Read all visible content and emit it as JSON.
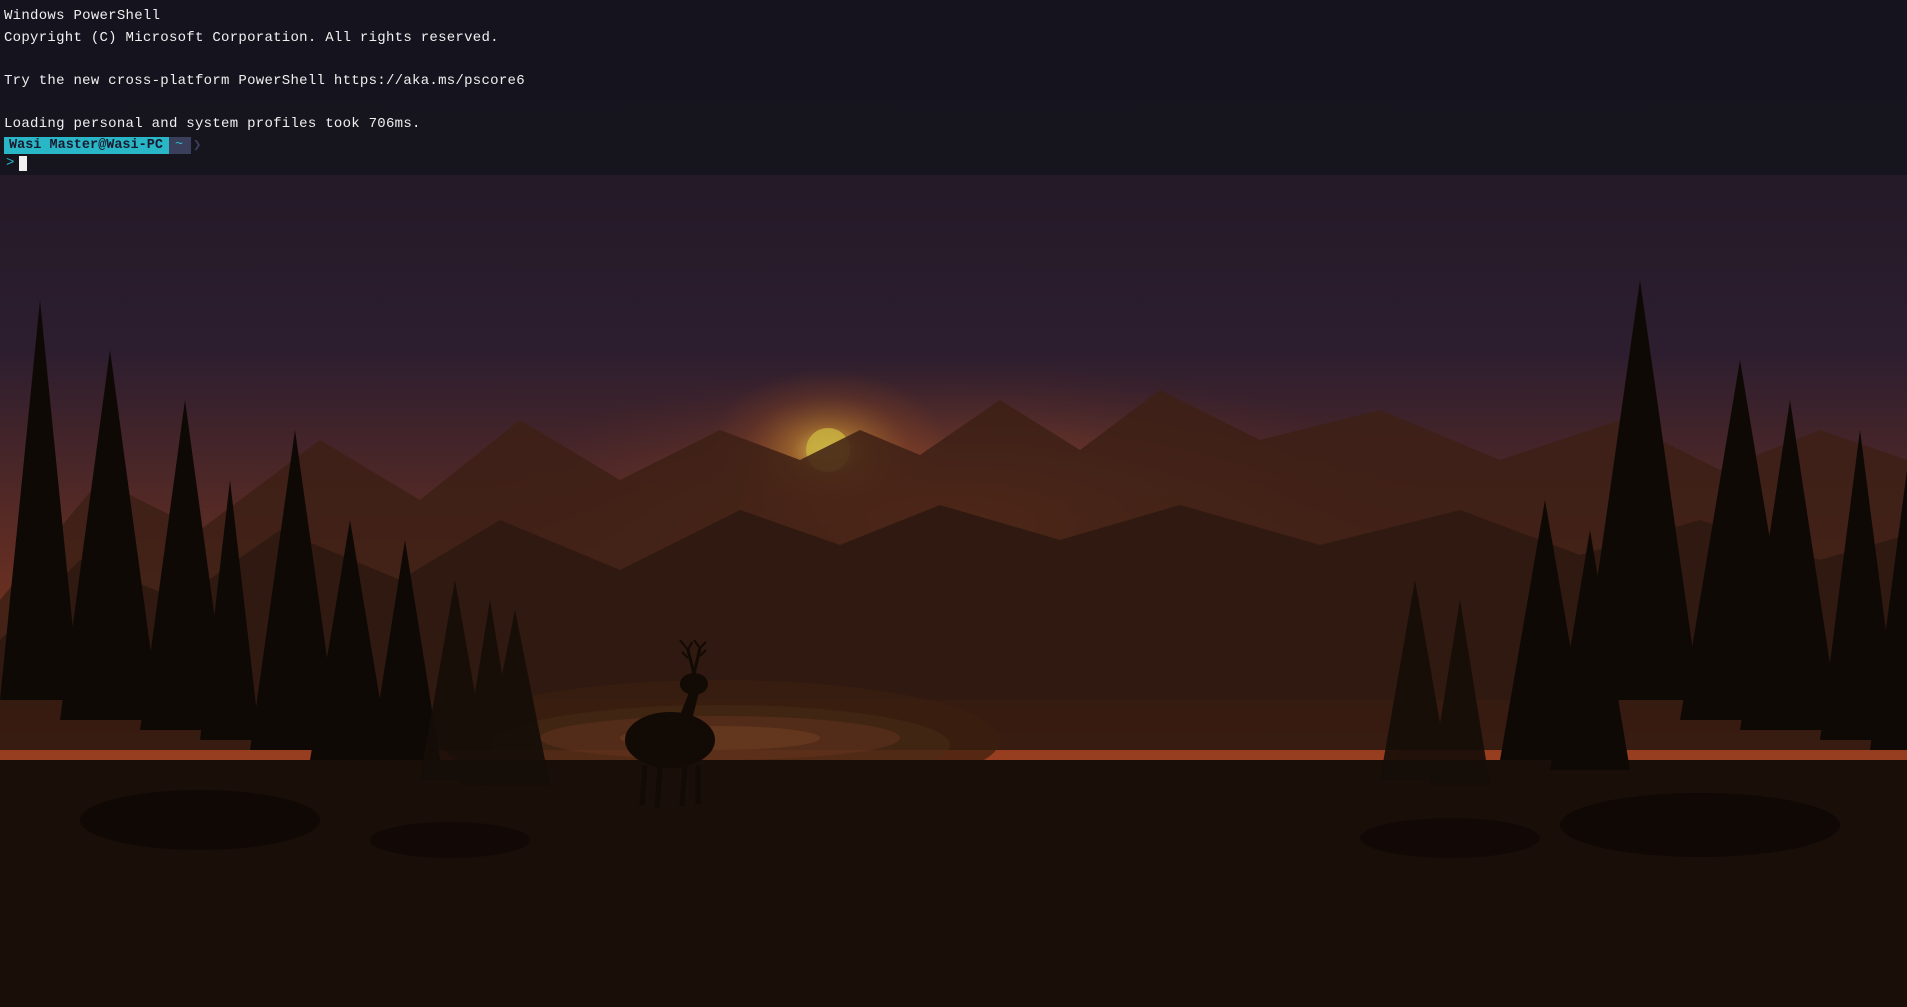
{
  "terminal": {
    "line1": "Windows PowerShell",
    "line2": "Copyright (C) Microsoft Corporation. All rights reserved.",
    "line3": "",
    "line4": "Try the new cross-platform PowerShell https://aka.ms/pscore6",
    "line5": "",
    "line6": "Loading personal and system profiles took 706ms.",
    "prompt_user": "Wasi Master@Wasi-PC",
    "prompt_tilde": "~",
    "prompt_arrow": ">"
  },
  "colors": {
    "terminal_bg": "rgba(20,20,30,0.88)",
    "terminal_text": "#f0f0f0",
    "prompt_cyan": "#29b6c7",
    "prompt_dark": "#3a3f5c"
  }
}
